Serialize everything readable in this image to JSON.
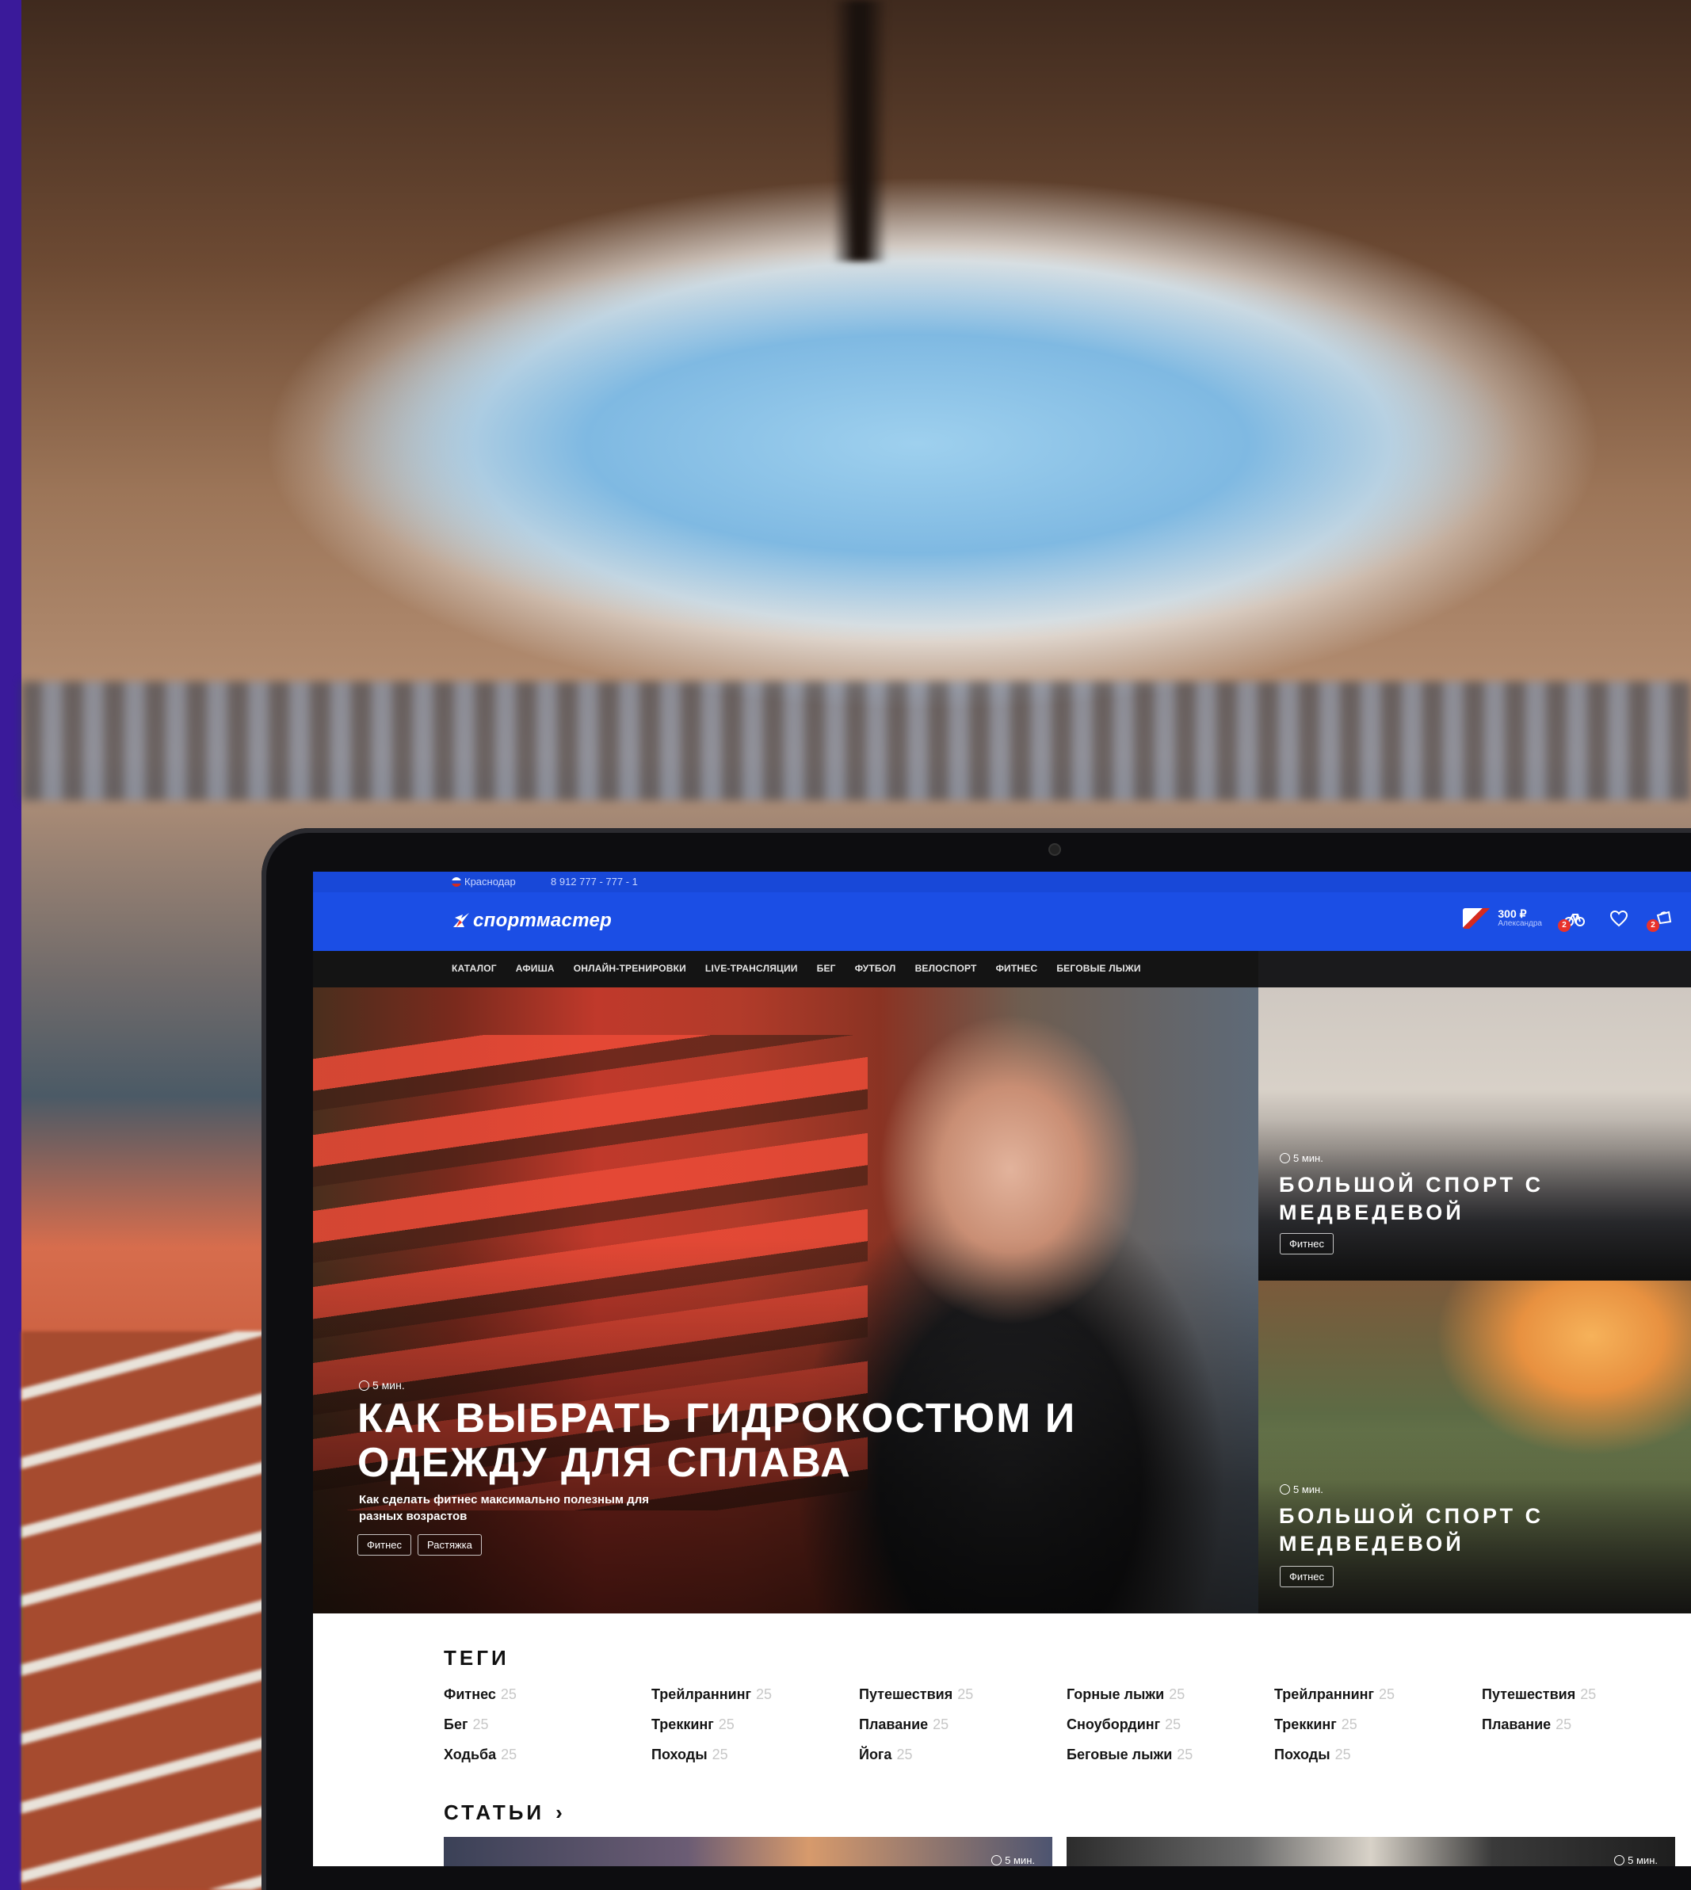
{
  "topbar": {
    "region": "Краснодар",
    "phone": "8 912 777 - 777 - 1"
  },
  "header": {
    "logo": "спортмастер",
    "bonus_amount": "300 ₽",
    "bonus_name": "Александра",
    "compare_badge": "2",
    "cart_badge": "2"
  },
  "nav": {
    "items": [
      "КАТАЛОГ",
      "АФИША",
      "ОНЛАЙН-ТРЕНИРОВКИ",
      "LIVE-ТРАНСЛЯЦИИ",
      "БЕГ",
      "ФУТБОЛ",
      "ВЕЛОСПОРТ",
      "ФИТНЕС",
      "БЕГОВЫЕ ЛЫЖИ"
    ]
  },
  "hero": {
    "read_time": "5 мин.",
    "title": "КАК ВЫБРАТЬ ГИДРОКОСТЮМ И ОДЕЖДУ ДЛЯ СПЛАВА",
    "subtitle": "Как сделать фитнес максимально полезным для разных возрастов",
    "tags": [
      "Фитнес",
      "Растяжка"
    ]
  },
  "side_cards": [
    {
      "read_time": "5 мин.",
      "title": "БОЛЬШОЙ СПОРТ С МЕДВЕДЕВОЙ",
      "tag": "Фитнес"
    },
    {
      "read_time": "5 мин.",
      "title": "БОЛЬШОЙ СПОРТ С МЕДВЕДЕВОЙ",
      "tag": "Фитнес"
    }
  ],
  "tags_section": {
    "title": "ТЕГИ",
    "items": [
      {
        "name": "Фитнес",
        "count": "25"
      },
      {
        "name": "Трейлраннинг",
        "count": "25"
      },
      {
        "name": "Путешествия",
        "count": "25"
      },
      {
        "name": "Горные лыжи",
        "count": "25"
      },
      {
        "name": "Трейлраннинг",
        "count": "25"
      },
      {
        "name": "Путешествия",
        "count": "25"
      },
      {
        "name": "Бег",
        "count": "25"
      },
      {
        "name": "Треккинг",
        "count": "25"
      },
      {
        "name": "Плавание",
        "count": "25"
      },
      {
        "name": "Сноубординг",
        "count": "25"
      },
      {
        "name": "Треккинг",
        "count": "25"
      },
      {
        "name": "Плавание",
        "count": "25"
      },
      {
        "name": "Ходьба",
        "count": "25"
      },
      {
        "name": "Походы",
        "count": "25"
      },
      {
        "name": "Йога",
        "count": "25"
      },
      {
        "name": "Беговые лыжи",
        "count": "25"
      },
      {
        "name": "Походы",
        "count": "25"
      }
    ]
  },
  "articles_section": {
    "title": "СТАТЬИ",
    "cards": [
      {
        "read_time": "5 мин."
      },
      {
        "read_time": "5 мин."
      }
    ]
  }
}
